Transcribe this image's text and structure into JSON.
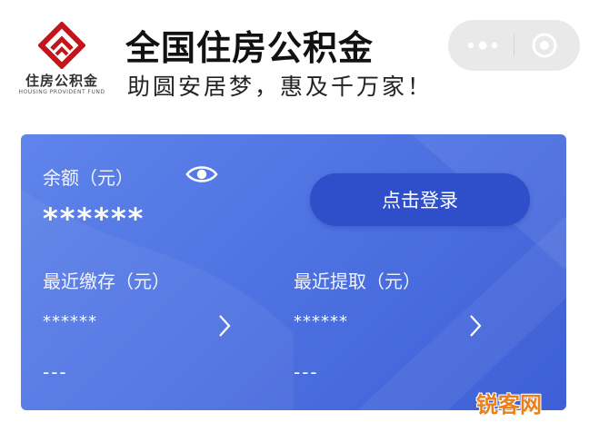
{
  "header": {
    "logo_text": "住房公积金",
    "logo_subtext": "HOUSING PROVIDENT FUND",
    "title": "全国住房公积金",
    "slogan": "助圆安居梦，惠及千万家！"
  },
  "capsule": {
    "icons": [
      "more-icon",
      "close-icon"
    ]
  },
  "card": {
    "balance_label": "余额（元）",
    "balance_value": "******",
    "login_button": "点击登录",
    "recent_deposit_label": "最近缴存（元）",
    "recent_deposit_value": "******",
    "recent_deposit_date": "---",
    "recent_withdraw_label": "最近提取（元）",
    "recent_withdraw_value": "******",
    "recent_withdraw_date": "---"
  },
  "watermark": "锐客网",
  "colors": {
    "brand_red": "#c3161c",
    "card_blue": "#4f73e2",
    "button_blue": "#2e4fc9",
    "watermark_orange": "#e8801e"
  }
}
